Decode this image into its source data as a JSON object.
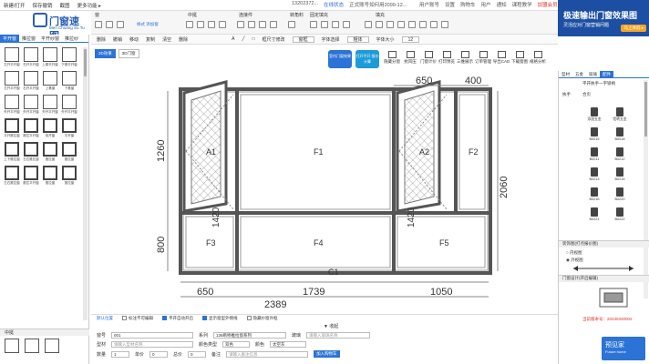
{
  "topbar": {
    "menu": [
      "新建/打开",
      "保存撤销",
      "截图",
      "更多功能 ▸"
    ],
    "center_items": [
      "13202372...",
      "在线状态",
      "正式账号如何用2099-12..."
    ],
    "right_items": [
      "用户账号",
      "设置",
      "购物车",
      "用户",
      "通知"
    ],
    "video": "课程教学",
    "member": "加盟会员"
  },
  "promo": {
    "line1": "极速输出门窗效果图",
    "line2": "灵活应对门窗营销问题",
    "button": "马上体验 ▸"
  },
  "logo": {
    "name": "门窗速图",
    "sub": "Men Chuang Su Tu"
  },
  "toolstrip": {
    "groups": [
      "窗",
      "中挺",
      "连接件",
      "转角料",
      "固定填充",
      "填充"
    ],
    "style_select": "样式 添加窗"
  },
  "toolbar2": {
    "items": [
      "删除",
      "撤销",
      "移动",
      "复制",
      "清空",
      "删除"
    ],
    "frame_label": "框尺寸修改",
    "frame_value": "窗框",
    "font_label": "字体选择",
    "font_value": "粗体",
    "size_label": "字体大小",
    "size_value": "12"
  },
  "left_panel": {
    "tabs": [
      "平开窗",
      "推拉窗",
      "平开纱窗",
      "推拉纱"
    ],
    "thumbs": [
      "左开平开窗",
      "右开平开窗",
      "上悬平开窗",
      "下悬平开窗",
      "左开平开窗",
      "右开平开窗",
      "上悬窗",
      "下悬窗",
      "外开平开窗",
      "外开平开窗",
      "外开平开窗",
      "外开平开窗",
      "平开推拉窗",
      "推拉平开窗",
      "双开窗",
      "平开窗",
      "上下推拉窗",
      "左右推拉窗",
      "推拉窗",
      "推拉窗",
      "左右推拉窗",
      "推拉平开窗",
      "推拉窗",
      "推拉窗"
    ],
    "section_title": "中挺"
  },
  "canvas": {
    "tabs": [
      "2D效果",
      "3D门窗"
    ],
    "badge1": "室内门窗效果",
    "badge2": "打开平开 报价计算",
    "actions": [
      "隐藏分窗",
      "抗风压",
      "门窗计价",
      "打印预览",
      "三维展示",
      "订单管理",
      "导出CAD",
      "下载窗图",
      "规格分析"
    ]
  },
  "window": {
    "labels": {
      "a1": "A1",
      "f1": "F1",
      "a2": "A2",
      "f2": "F2",
      "f3": "F3",
      "f4": "F4",
      "f5": "F5",
      "c1": "C1"
    },
    "dims": {
      "top1": "650",
      "top2": "400",
      "left1": "1260",
      "left2": "800",
      "mid": "1420",
      "mid2": "1420",
      "right": "2060",
      "bot1": "650",
      "bot2": "1739",
      "bot3": "1050",
      "total": "2389"
    }
  },
  "right_panel": {
    "tabs": [
      "型材",
      "五金",
      "玻璃",
      "配件"
    ],
    "subtitle": "平开执手一字锁柄",
    "item1": "执手",
    "item2": "合页",
    "parts": [
      "添加五金",
      "铝转五金",
      "B0015",
      "B0018",
      "B0211",
      "B0212",
      "B0213",
      "B0215",
      "B0216",
      "B0220",
      "B0221",
      "B0222"
    ],
    "section1": "装饰图(打点报价图)",
    "radio1": "内视图",
    "radio2": "外视图",
    "section2": "门窗设计(开启编辑)",
    "footer": "当前版本号：20230330002"
  },
  "status": {
    "v1": "默认位置",
    "v2": "标注不可编辑",
    "v3": "平开自动开启",
    "v4": "显示窗型外侧线",
    "v5": "隐藏纱窗外框"
  },
  "collapse": "收起",
  "form": {
    "name_label": "窗号",
    "name_value": "001",
    "series_label": "系列",
    "series_value": "136断桥推拉窗系列",
    "glass_label": "玻璃",
    "glass_ph": "请输入玻璃名称",
    "part_label": "型材",
    "part_ph": "请输入型材名称",
    "color_label": "颜色类型",
    "color_value": "双色",
    "color2_label": "颜色",
    "color2_value": "太空灰",
    "qty_label": "数量",
    "qty_value": "1",
    "unit_label": "单价",
    "unit_value": "0",
    "total_label": "总价",
    "total_value": "0",
    "note_label": "备注",
    "note_ph": "请输入备注信息",
    "add_btn": "加入购物车"
  },
  "corner": {
    "name": "预见家",
    "sub": "Future home"
  }
}
